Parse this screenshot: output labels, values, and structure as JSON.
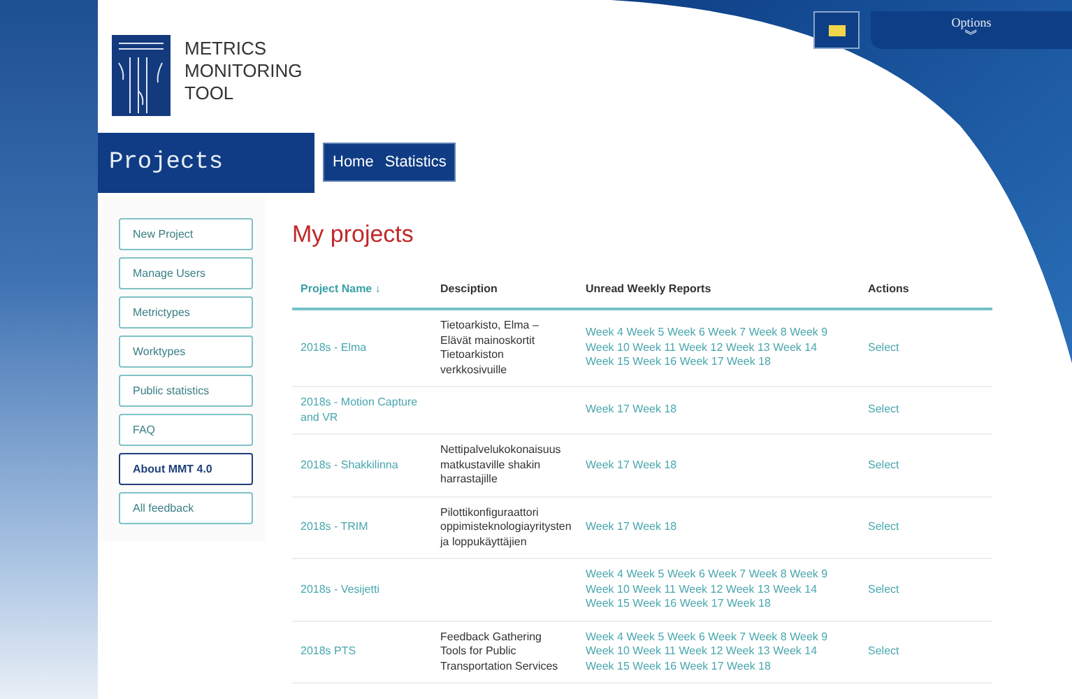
{
  "logo": {
    "lines": [
      "METRICS",
      "MONITORING",
      "TOOL"
    ]
  },
  "options": {
    "label": "Options",
    "arrow": "︾"
  },
  "page_title": "Projects",
  "nav": [
    {
      "label": "Home"
    },
    {
      "label": "Statistics"
    }
  ],
  "sidebar": {
    "items": [
      {
        "label": "New Project",
        "selected": false
      },
      {
        "label": "Manage Users",
        "selected": false
      },
      {
        "label": "Metrictypes",
        "selected": false
      },
      {
        "label": "Worktypes",
        "selected": false
      },
      {
        "label": "Public statistics",
        "selected": false
      },
      {
        "label": "FAQ",
        "selected": false
      },
      {
        "label": "About MMT 4.0",
        "selected": true
      },
      {
        "label": "All feedback",
        "selected": false
      }
    ]
  },
  "heading": "My projects",
  "table": {
    "columns": [
      {
        "label": "Project Name ↓",
        "sortable": true
      },
      {
        "label": "Desciption",
        "sortable": false
      },
      {
        "label": "Unread Weekly Reports",
        "sortable": false
      },
      {
        "label": "Actions",
        "sortable": false
      }
    ],
    "rows": [
      {
        "name": "2018s - Elma",
        "description": "Tietoarkisto, Elma – Elävät mainoskortit Tietoarkiston verkkosivuille",
        "weeks": [
          "Week 4",
          "Week 5",
          "Week 6",
          "Week 7",
          "Week 8",
          "Week 9",
          "Week 10",
          "Week 11",
          "Week 12",
          "Week 13",
          "Week 14",
          "Week 15",
          "Week 16",
          "Week 17",
          "Week 18"
        ],
        "action": "Select"
      },
      {
        "name": "2018s - Motion Capture and VR",
        "weeks": [
          "Week 17",
          "Week 18"
        ],
        "action": "Select"
      },
      {
        "name": "2018s - Shakkilinna",
        "description": "Nettipalvelukokonaisuus matkustaville shakin harrastajille",
        "weeks": [
          "Week 17",
          "Week 18"
        ],
        "action": "Select"
      },
      {
        "name": "2018s - TRIM",
        "description": "Pilottikonfiguraattori oppimisteknologiayritysten ja loppukäyttäjien",
        "weeks": [
          "Week 17",
          "Week 18"
        ],
        "action": "Select"
      },
      {
        "name": "2018s - Vesijetti",
        "weeks": [
          "Week 4",
          "Week 5",
          "Week 6",
          "Week 7",
          "Week 8",
          "Week 9",
          "Week 10",
          "Week 11",
          "Week 12",
          "Week 13",
          "Week 14",
          "Week 15",
          "Week 16",
          "Week 17",
          "Week 18"
        ],
        "action": "Select"
      },
      {
        "name": "2018s PTS",
        "description": "Feedback Gathering Tools for Public Transportation Services",
        "weeks": [
          "Week 4",
          "Week 5",
          "Week 6",
          "Week 7",
          "Week 8",
          "Week 9",
          "Week 10",
          "Week 11",
          "Week 12",
          "Week 13",
          "Week 14",
          "Week 15",
          "Week 16",
          "Week 17",
          "Week 18"
        ],
        "action": "Select"
      }
    ]
  }
}
